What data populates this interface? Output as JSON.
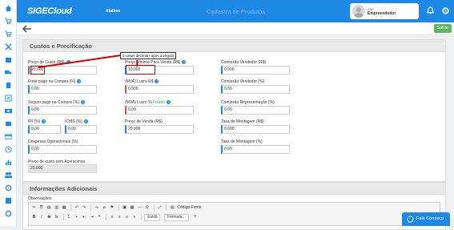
{
  "header": {
    "logo": "SIGECloud",
    "shortcut": "Atalhos",
    "page_title": "Cadastro de Produtos",
    "user_small": "CW",
    "user_name": "Empreendedor"
  },
  "toolbar": {
    "save_label": "Salvar"
  },
  "costs": {
    "title": "Custos e Precificação",
    "tooltip": "3 casas decimais após a vírgula",
    "fields": {
      "preco_custo": {
        "label": "Preço de Custo (R$)",
        "value": "20,000"
      },
      "frete": {
        "label": "Frete pago na Compra (%)",
        "value": "0,00"
      },
      "seguro": {
        "label": "Seguro pago na Compra (%)",
        "value": "0,00"
      },
      "ipi": {
        "label": "IPI (%)",
        "value": "0,00"
      },
      "icms": {
        "label": "ICMS (%)",
        "value": "0,00"
      },
      "despesas": {
        "label": "Despesas Operacionais (%)",
        "value": "0,00"
      },
      "custo_acrescimos": {
        "label": "Preço de custo com Acréscimos",
        "value": "20,000"
      },
      "preco_minimo": {
        "label": "Preço Mínimo Para Venda (R$)",
        "value": "10,000"
      },
      "mva_rs": {
        "label": "(MVA) Lucro R$",
        "value": "0,000"
      },
      "mva_pct_prefix": {
        "label": "(MVA) Lucro %",
        "label_green": "Fixado",
        "value": "0,00"
      },
      "preco_venda": {
        "label": "Preço de Venda (R$)",
        "value": "20,000"
      },
      "comissao1": {
        "label": "Comissão Vendedor (R$)",
        "value": "0,000"
      },
      "comissao2": {
        "label": "Comissão Vendedor (%)",
        "value": "0,00"
      },
      "comissao_rep": {
        "label": "Comissão Representação (%)",
        "value": "0,00"
      },
      "montagem_rs": {
        "label": "Taxa de Montagem (R$)",
        "value": "0,000"
      },
      "montagem_pct": {
        "label": "Taxa de Montagem (%)",
        "value": "0,00"
      }
    }
  },
  "additional": {
    "title": "Informações Adicionais",
    "observacoes_label": "Observações",
    "editor": {
      "source_label": "Código-Fonte",
      "style_select": "Estilo",
      "format_select": "Formata..."
    }
  },
  "chat": {
    "label": "Fale Conosco"
  },
  "colors": {
    "primary": "#1e88e5",
    "success": "#5cb85c",
    "highlight": "#d00000"
  }
}
